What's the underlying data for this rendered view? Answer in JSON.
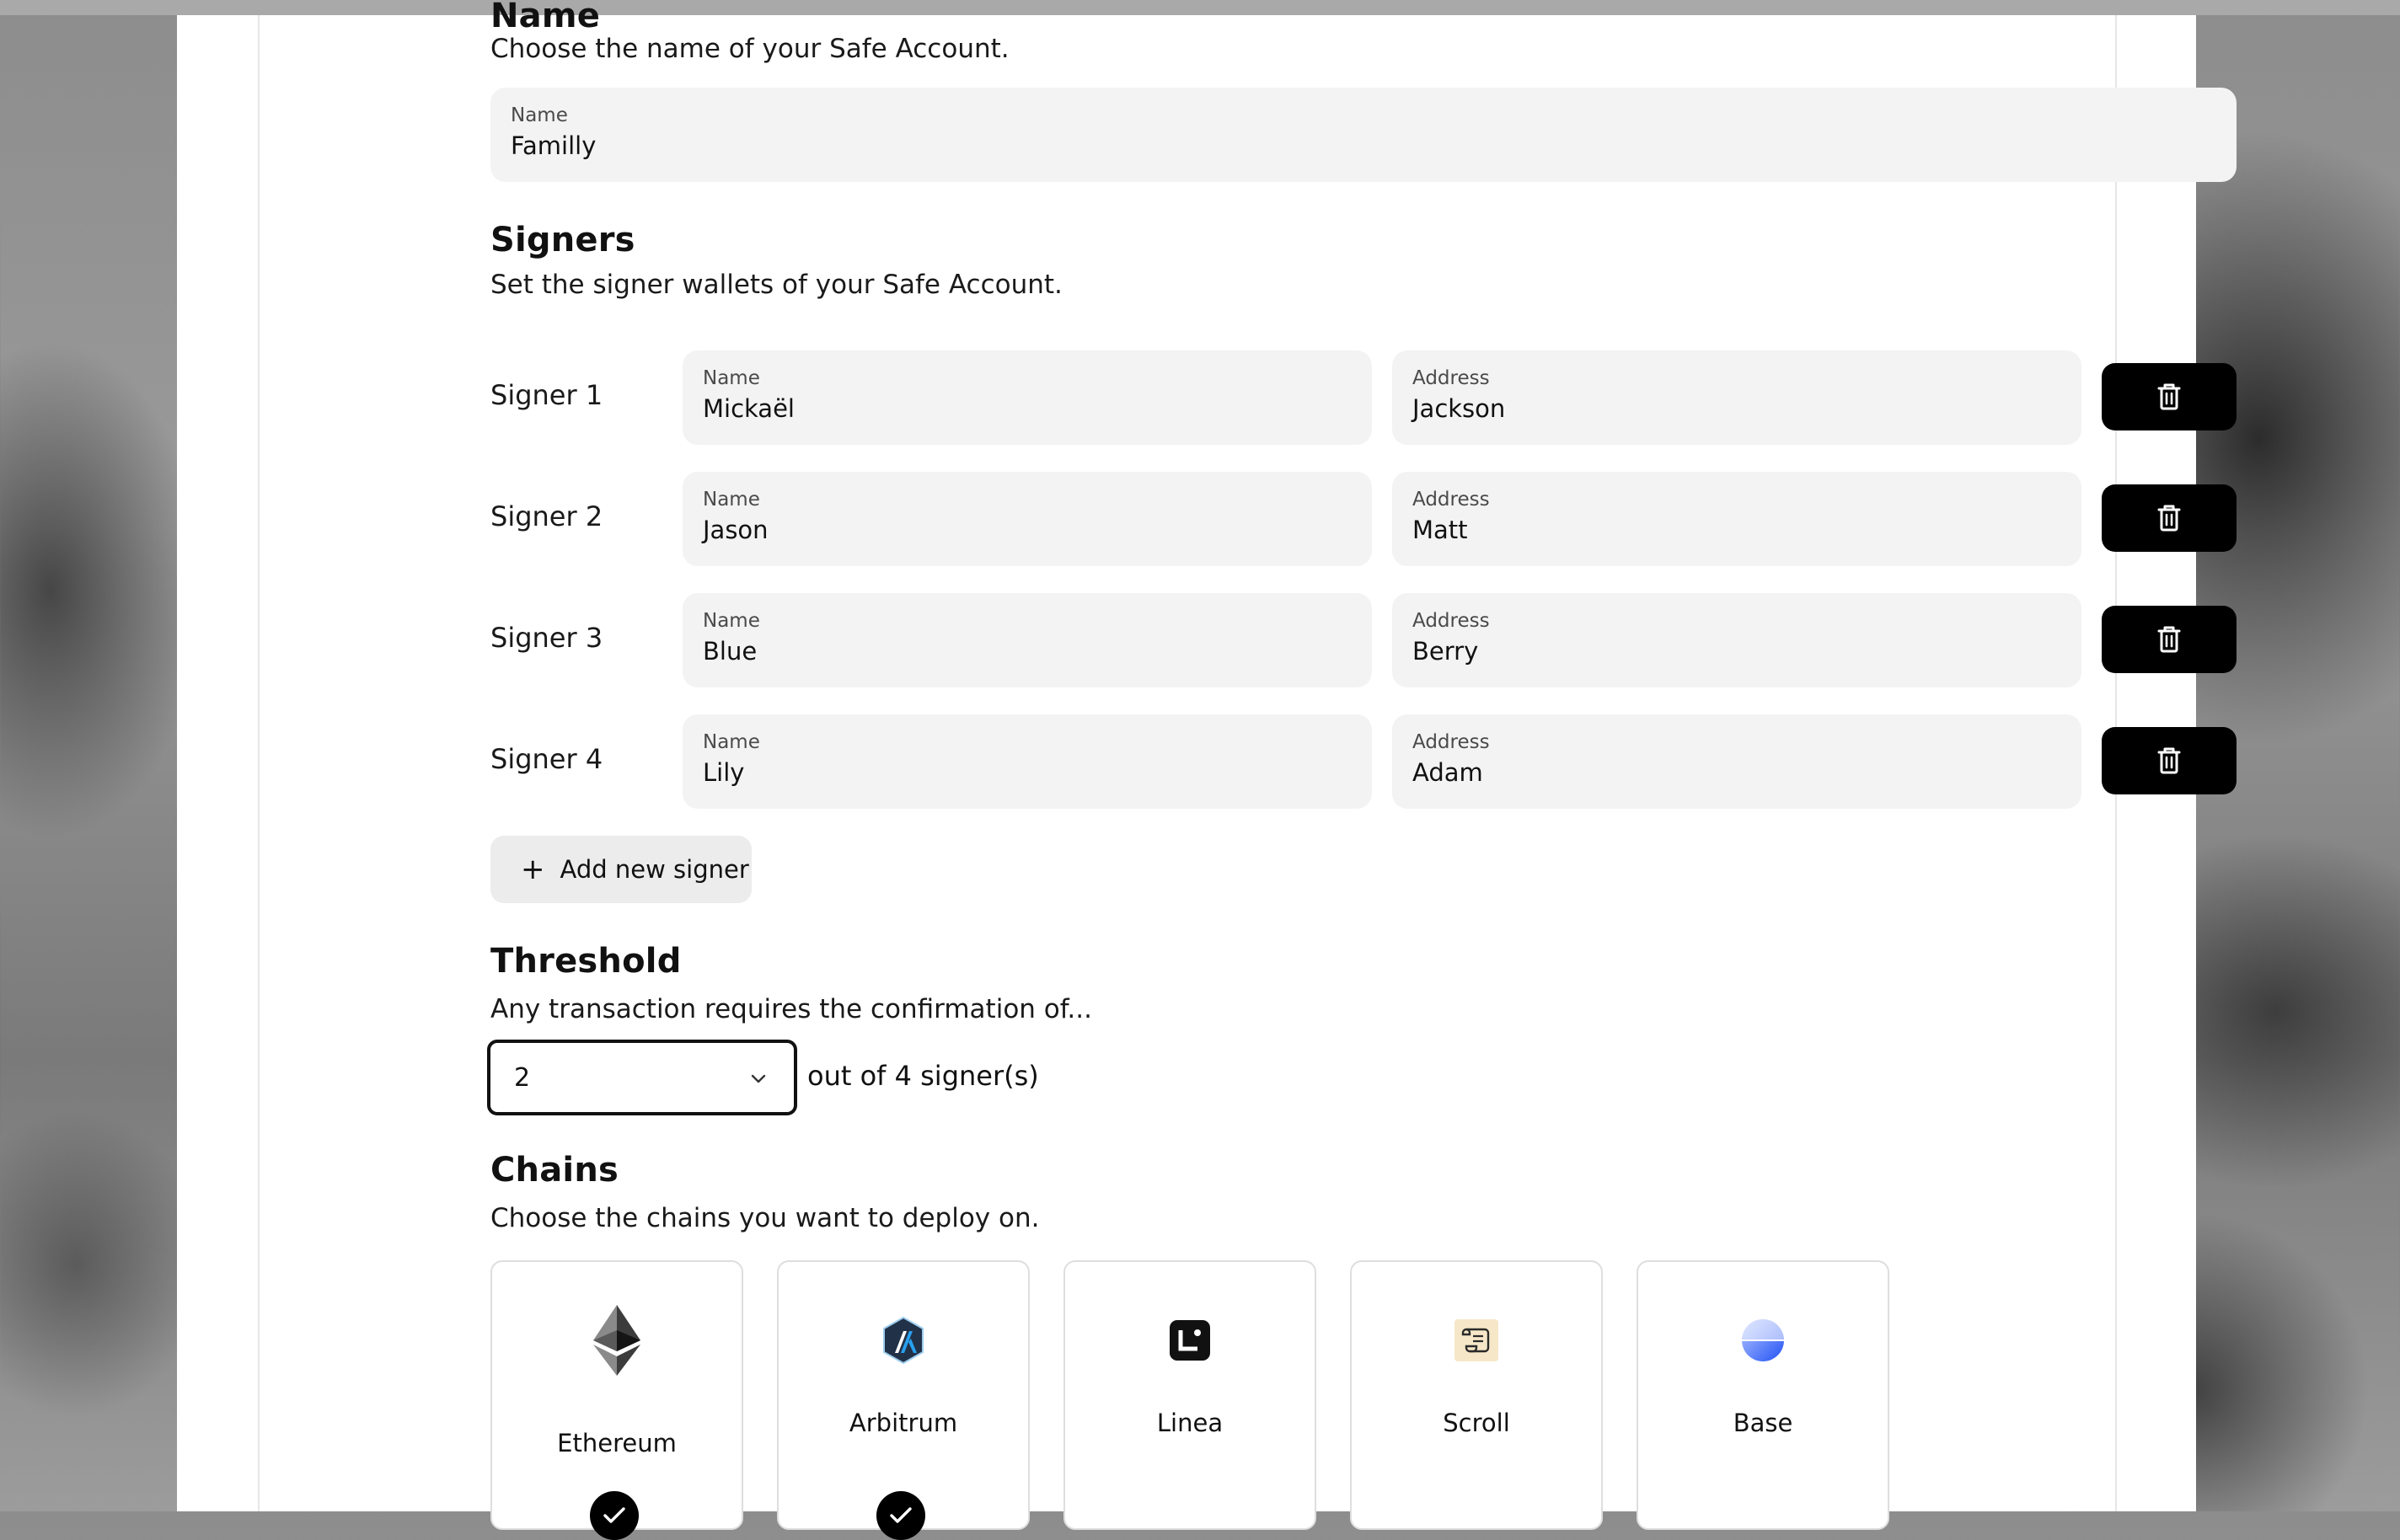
{
  "name_section": {
    "heading": "Name",
    "subtitle": "Choose the name of your Safe Account.",
    "field_label": "Name",
    "field_value": "Familly"
  },
  "signers_section": {
    "heading": "Signers",
    "subtitle": "Set the signer wallets of your Safe Account.",
    "signers": [
      {
        "label": "Signer 1",
        "name_label": "Name",
        "name": "Mickaël",
        "address_label": "Address",
        "address": "Jackson"
      },
      {
        "label": "Signer 2",
        "name_label": "Name",
        "name": "Jason",
        "address_label": "Address",
        "address": "Matt"
      },
      {
        "label": "Signer 3",
        "name_label": "Name",
        "name": "Blue",
        "address_label": "Address",
        "address": "Berry"
      },
      {
        "label": "Signer 4",
        "name_label": "Name",
        "name": "Lily",
        "address_label": "Address",
        "address": "Adam"
      }
    ],
    "add_button_label": "Add new signer",
    "delete_icon": "trash-icon"
  },
  "threshold_section": {
    "heading": "Threshold",
    "subtitle": "Any transaction requires the confirmation of...",
    "selected_value": "2",
    "suffix": "out of 4 signer(s)"
  },
  "chains_section": {
    "heading": "Chains",
    "subtitle": "Choose the chains you want to deploy on.",
    "chains": [
      {
        "name": "Ethereum",
        "icon": "ethereum-icon",
        "selected": true
      },
      {
        "name": "Arbitrum",
        "icon": "arbitrum-icon",
        "selected": true
      },
      {
        "name": "Linea",
        "icon": "linea-icon",
        "selected": false
      },
      {
        "name": "Scroll",
        "icon": "scroll-icon",
        "selected": false
      },
      {
        "name": "Base",
        "icon": "base-icon",
        "selected": false
      }
    ]
  },
  "colors": {
    "field_bg": "#f3f3f3",
    "button_dark": "#000000",
    "button_light": "#ececec",
    "arbitrum_blue": "#28a0f0",
    "base_blue": "#2151f5",
    "scroll_bg": "#f6e7c8"
  }
}
